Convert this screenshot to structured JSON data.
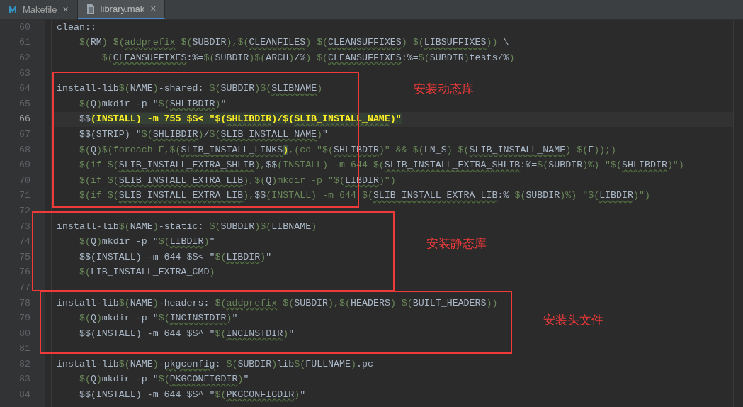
{
  "tabs": [
    {
      "label": "Makefile",
      "kind": "makefile",
      "selected": false,
      "close": "×"
    },
    {
      "label": "library.mak",
      "kind": "text",
      "selected": true,
      "close": "×"
    }
  ],
  "editor": {
    "lines": [
      {
        "number": "60",
        "current": false,
        "tokens": [
          {
            "kind": "plain",
            "text": "clean::"
          }
        ]
      },
      {
        "number": "61",
        "current": false,
        "tokens": [
          {
            "kind": "macro",
            "text": "    $("
          },
          {
            "kind": "plain",
            "text": "RM"
          },
          {
            "kind": "macro",
            "text": ") $("
          },
          {
            "kind": "func",
            "text": "addprefix"
          },
          {
            "kind": "macro",
            "text": " $("
          },
          {
            "kind": "plain",
            "text": "SUBDIR"
          },
          {
            "kind": "macro",
            "text": "),$("
          },
          {
            "kind": "ident",
            "text": "CLEANFILES"
          },
          {
            "kind": "macro",
            "text": ") $("
          },
          {
            "kind": "ident",
            "text": "CLEANSUFFIXES"
          },
          {
            "kind": "macro",
            "text": ") $("
          },
          {
            "kind": "ident",
            "text": "LIBSUFFIXES"
          },
          {
            "kind": "macro",
            "text": "))"
          },
          {
            "kind": "plain",
            "text": " \\"
          }
        ]
      },
      {
        "number": "62",
        "current": false,
        "tokens": [
          {
            "kind": "macro",
            "text": "        $("
          },
          {
            "kind": "ident",
            "text": "CLEANSUFFIXES"
          },
          {
            "kind": "plain",
            "text": ":%="
          },
          {
            "kind": "macro",
            "text": "$("
          },
          {
            "kind": "plain",
            "text": "SUBDIR"
          },
          {
            "kind": "macro",
            "text": ")$("
          },
          {
            "kind": "plain",
            "text": "ARCH"
          },
          {
            "kind": "macro",
            "text": ")"
          },
          {
            "kind": "plain",
            "text": "/%"
          },
          {
            "kind": "macro",
            "text": ") $("
          },
          {
            "kind": "ident",
            "text": "CLEANSUFFIXES"
          },
          {
            "kind": "plain",
            "text": ":%="
          },
          {
            "kind": "macro",
            "text": "$("
          },
          {
            "kind": "plain",
            "text": "SUBDIR"
          },
          {
            "kind": "macro",
            "text": ")"
          },
          {
            "kind": "plain",
            "text": "tests/%"
          },
          {
            "kind": "macro",
            "text": ")"
          }
        ]
      },
      {
        "number": "63",
        "current": false
      },
      {
        "number": "64",
        "current": false,
        "tokens": [
          {
            "kind": "plain",
            "text": "install-lib"
          },
          {
            "kind": "macro",
            "text": "$("
          },
          {
            "kind": "plain",
            "text": "NAME"
          },
          {
            "kind": "macro",
            "text": ")"
          },
          {
            "kind": "plain",
            "text": "-shared: "
          },
          {
            "kind": "macro",
            "text": "$("
          },
          {
            "kind": "plain",
            "text": "SUBDIR"
          },
          {
            "kind": "macro",
            "text": ")$("
          },
          {
            "kind": "ident",
            "text": "SLIBNAME"
          },
          {
            "kind": "macro",
            "text": ")"
          }
        ]
      },
      {
        "number": "65",
        "current": false,
        "tokens": [
          {
            "kind": "macro",
            "text": "    $("
          },
          {
            "kind": "plain",
            "text": "Q"
          },
          {
            "kind": "macro",
            "text": ")"
          },
          {
            "kind": "plain",
            "text": "mkdir -p \""
          },
          {
            "kind": "macro",
            "text": "$("
          },
          {
            "kind": "ident",
            "text": "SHLIBDIR"
          },
          {
            "kind": "macro",
            "text": ")"
          },
          {
            "kind": "plain",
            "text": "\""
          }
        ]
      },
      {
        "number": "66",
        "current": true,
        "tokens": [
          {
            "kind": "plain",
            "text": "    $$"
          },
          {
            "kind": "hl",
            "text": "(INSTALL) -m 755 $$< \"$("
          },
          {
            "kind": "hlident",
            "text": "SHLIBDIR"
          },
          {
            "kind": "hl",
            "text": ")/$("
          },
          {
            "kind": "hlident",
            "text": "SLIB_INSTALL_NAME"
          },
          {
            "kind": "hl",
            "text": ")\""
          }
        ]
      },
      {
        "number": "67",
        "current": false,
        "tokens": [
          {
            "kind": "plain",
            "text": "    $$(STRIP) \""
          },
          {
            "kind": "macro",
            "text": "$("
          },
          {
            "kind": "ident",
            "text": "SHLIBDIR"
          },
          {
            "kind": "macro",
            "text": ")"
          },
          {
            "kind": "plain",
            "text": "/"
          },
          {
            "kind": "macro",
            "text": "$("
          },
          {
            "kind": "ident",
            "text": "SLIB_INSTALL_NAME"
          },
          {
            "kind": "macro",
            "text": ")"
          },
          {
            "kind": "plain",
            "text": "\""
          }
        ]
      },
      {
        "number": "68",
        "current": false,
        "tokens": [
          {
            "kind": "macro",
            "text": "    $("
          },
          {
            "kind": "plain",
            "text": "Q"
          },
          {
            "kind": "macro",
            "text": ")$(foreach F,$("
          },
          {
            "kind": "ident",
            "text": "SLIB_INSTALL_LINKS"
          },
          {
            "kind": "brace",
            "text": ")"
          },
          {
            "kind": "macro",
            "text": ",(cd \"$("
          },
          {
            "kind": "ident",
            "text": "SHLIBDIR"
          },
          {
            "kind": "macro",
            "text": ")\" && $("
          },
          {
            "kind": "plain",
            "text": "LN_S"
          },
          {
            "kind": "macro",
            "text": ") $("
          },
          {
            "kind": "ident",
            "text": "SLIB_INSTALL_NAME"
          },
          {
            "kind": "macro",
            "text": ") $("
          },
          {
            "kind": "plain",
            "text": "F"
          },
          {
            "kind": "macro",
            "text": "));)"
          }
        ]
      },
      {
        "number": "69",
        "current": false,
        "tokens": [
          {
            "kind": "macro",
            "text": "    $(if $("
          },
          {
            "kind": "ident",
            "text": "SLIB_INSTALL_EXTRA_SHLIB"
          },
          {
            "kind": "macro",
            "text": "),"
          },
          {
            "kind": "plain",
            "text": "$$"
          },
          {
            "kind": "macro",
            "text": "(INSTALL) -m 644 $("
          },
          {
            "kind": "ident",
            "text": "SLIB_INSTALL_EXTRA_SHLIB"
          },
          {
            "kind": "plain",
            "text": ":%="
          },
          {
            "kind": "macro",
            "text": "$("
          },
          {
            "kind": "plain",
            "text": "SUBDIR"
          },
          {
            "kind": "macro",
            "text": ")%) \"$("
          },
          {
            "kind": "ident",
            "text": "SHLIBDIR"
          },
          {
            "kind": "macro",
            "text": ")\")"
          }
        ]
      },
      {
        "number": "70",
        "current": false,
        "tokens": [
          {
            "kind": "macro",
            "text": "    $(if $("
          },
          {
            "kind": "ident",
            "text": "SLIB_INSTALL_EXTRA_LIB"
          },
          {
            "kind": "macro",
            "text": "),$("
          },
          {
            "kind": "plain",
            "text": "Q"
          },
          {
            "kind": "macro",
            "text": ")mkdir -p \"$("
          },
          {
            "kind": "ident",
            "text": "LIBDIR"
          },
          {
            "kind": "macro",
            "text": ")\")"
          }
        ]
      },
      {
        "number": "71",
        "current": false,
        "tokens": [
          {
            "kind": "macro",
            "text": "    $(if $("
          },
          {
            "kind": "ident",
            "text": "SLIB_INSTALL_EXTRA_LIB"
          },
          {
            "kind": "macro",
            "text": "),"
          },
          {
            "kind": "plain",
            "text": "$$"
          },
          {
            "kind": "macro",
            "text": "(INSTALL) -m 644 $("
          },
          {
            "kind": "ident",
            "text": "SLIB_INSTALL_EXTRA_LIB"
          },
          {
            "kind": "plain",
            "text": ":%="
          },
          {
            "kind": "macro",
            "text": "$("
          },
          {
            "kind": "plain",
            "text": "SUBDIR"
          },
          {
            "kind": "macro",
            "text": ")%) \"$("
          },
          {
            "kind": "ident",
            "text": "LIBDIR"
          },
          {
            "kind": "macro",
            "text": ")\")"
          }
        ]
      },
      {
        "number": "72",
        "current": false
      },
      {
        "number": "73",
        "current": false,
        "tokens": [
          {
            "kind": "plain",
            "text": "install-lib"
          },
          {
            "kind": "macro",
            "text": "$("
          },
          {
            "kind": "plain",
            "text": "NAME"
          },
          {
            "kind": "macro",
            "text": ")"
          },
          {
            "kind": "plain",
            "text": "-static: "
          },
          {
            "kind": "macro",
            "text": "$("
          },
          {
            "kind": "plain",
            "text": "SUBDIR"
          },
          {
            "kind": "macro",
            "text": ")$("
          },
          {
            "kind": "plain",
            "text": "LIBNAME"
          },
          {
            "kind": "macro",
            "text": ")"
          }
        ]
      },
      {
        "number": "74",
        "current": false,
        "tokens": [
          {
            "kind": "macro",
            "text": "    $("
          },
          {
            "kind": "plain",
            "text": "Q"
          },
          {
            "kind": "macro",
            "text": ")"
          },
          {
            "kind": "plain",
            "text": "mkdir -p \""
          },
          {
            "kind": "macro",
            "text": "$("
          },
          {
            "kind": "ident",
            "text": "LIBDIR"
          },
          {
            "kind": "macro",
            "text": ")"
          },
          {
            "kind": "plain",
            "text": "\""
          }
        ]
      },
      {
        "number": "75",
        "current": false,
        "tokens": [
          {
            "kind": "plain",
            "text": "    $$(INSTALL) -m 644 $$< \""
          },
          {
            "kind": "macro",
            "text": "$("
          },
          {
            "kind": "ident",
            "text": "LIBDIR"
          },
          {
            "kind": "macro",
            "text": ")"
          },
          {
            "kind": "plain",
            "text": "\""
          }
        ]
      },
      {
        "number": "76",
        "current": false,
        "tokens": [
          {
            "kind": "macro",
            "text": "    $("
          },
          {
            "kind": "plain",
            "text": "LIB_INSTALL_EXTRA_CMD"
          },
          {
            "kind": "macro",
            "text": ")"
          }
        ]
      },
      {
        "number": "77",
        "current": false
      },
      {
        "number": "78",
        "current": false,
        "tokens": [
          {
            "kind": "plain",
            "text": "install-lib"
          },
          {
            "kind": "macro",
            "text": "$("
          },
          {
            "kind": "plain",
            "text": "NAME"
          },
          {
            "kind": "macro",
            "text": ")"
          },
          {
            "kind": "plain",
            "text": "-headers: "
          },
          {
            "kind": "macro",
            "text": "$("
          },
          {
            "kind": "func",
            "text": "addprefix"
          },
          {
            "kind": "macro",
            "text": " $("
          },
          {
            "kind": "plain",
            "text": "SUBDIR"
          },
          {
            "kind": "macro",
            "text": "),$("
          },
          {
            "kind": "plain",
            "text": "HEADERS"
          },
          {
            "kind": "macro",
            "text": ") $("
          },
          {
            "kind": "plain",
            "text": "BUILT_HEADERS"
          },
          {
            "kind": "macro",
            "text": "))"
          }
        ]
      },
      {
        "number": "79",
        "current": false,
        "tokens": [
          {
            "kind": "macro",
            "text": "    $("
          },
          {
            "kind": "plain",
            "text": "Q"
          },
          {
            "kind": "macro",
            "text": ")"
          },
          {
            "kind": "plain",
            "text": "mkdir -p \""
          },
          {
            "kind": "macro",
            "text": "$("
          },
          {
            "kind": "ident",
            "text": "INCINSTDIR"
          },
          {
            "kind": "macro",
            "text": ")"
          },
          {
            "kind": "plain",
            "text": "\""
          }
        ]
      },
      {
        "number": "80",
        "current": false,
        "tokens": [
          {
            "kind": "plain",
            "text": "    $$(INSTALL) -m 644 $$^ \""
          },
          {
            "kind": "macro",
            "text": "$("
          },
          {
            "kind": "ident",
            "text": "INCINSTDIR"
          },
          {
            "kind": "macro",
            "text": ")"
          },
          {
            "kind": "plain",
            "text": "\""
          }
        ]
      },
      {
        "number": "81",
        "current": false
      },
      {
        "number": "82",
        "current": false,
        "tokens": [
          {
            "kind": "plain",
            "text": "install-lib"
          },
          {
            "kind": "macro",
            "text": "$("
          },
          {
            "kind": "plain",
            "text": "NAME"
          },
          {
            "kind": "macro",
            "text": ")"
          },
          {
            "kind": "plain",
            "text": "-"
          },
          {
            "kind": "ident",
            "text": "pkgconfig"
          },
          {
            "kind": "plain",
            "text": ": "
          },
          {
            "kind": "macro",
            "text": "$("
          },
          {
            "kind": "plain",
            "text": "SUBDIR"
          },
          {
            "kind": "macro",
            "text": ")"
          },
          {
            "kind": "plain",
            "text": "lib"
          },
          {
            "kind": "macro",
            "text": "$("
          },
          {
            "kind": "plain",
            "text": "FULLNAME"
          },
          {
            "kind": "macro",
            "text": ")"
          },
          {
            "kind": "plain",
            "text": ".pc"
          }
        ]
      },
      {
        "number": "83",
        "current": false,
        "tokens": [
          {
            "kind": "macro",
            "text": "    $("
          },
          {
            "kind": "plain",
            "text": "Q"
          },
          {
            "kind": "macro",
            "text": ")"
          },
          {
            "kind": "plain",
            "text": "mkdir -p \""
          },
          {
            "kind": "macro",
            "text": "$("
          },
          {
            "kind": "ident",
            "text": "PKGCONFIGDIR"
          },
          {
            "kind": "macro",
            "text": ")"
          },
          {
            "kind": "plain",
            "text": "\""
          }
        ]
      },
      {
        "number": "84",
        "current": false,
        "tokens": [
          {
            "kind": "plain",
            "text": "    $$(INSTALL) -m 644 $$^ \""
          },
          {
            "kind": "macro",
            "text": "$("
          },
          {
            "kind": "ident",
            "text": "PKGCONFIGDIR"
          },
          {
            "kind": "macro",
            "text": ")"
          },
          {
            "kind": "plain",
            "text": "\""
          }
        ]
      }
    ]
  },
  "annotations": [
    {
      "label": "安装动态库"
    },
    {
      "label": "安装静态库"
    },
    {
      "label": "安装头文件"
    }
  ]
}
